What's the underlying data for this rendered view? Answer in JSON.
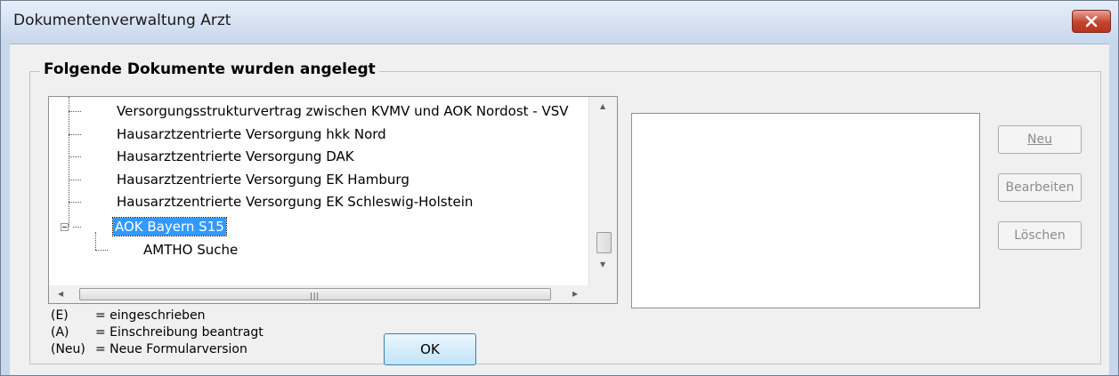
{
  "window": {
    "title": "Dokumentenverwaltung Arzt"
  },
  "group": {
    "label": "Folgende Dokumente wurden angelegt"
  },
  "tree": {
    "items": [
      "Versorgungsstrukturvertrag zwischen KVMV und AOK Nordost - VSV",
      "Hausarztzentrierte Versorgung hkk Nord",
      "Hausarztzentrierte Versorgung DAK",
      "Hausarztzentrierte Versorgung EK Hamburg",
      "Hausarztzentrierte Versorgung EK Schleswig-Holstein"
    ],
    "selected": "AOK Bayern S15",
    "child": "AMTHO Suche"
  },
  "legend": [
    {
      "key": "(E)",
      "text": "= eingeschrieben"
    },
    {
      "key": "(A)",
      "text": "= Einschreibung beantragt"
    },
    {
      "key": "(Neu)",
      "text": "= Neue Formularversion"
    }
  ],
  "buttons": {
    "ok": "OK",
    "new": "Neu",
    "edit": "Bearbeiten",
    "delete": "Löschen"
  }
}
